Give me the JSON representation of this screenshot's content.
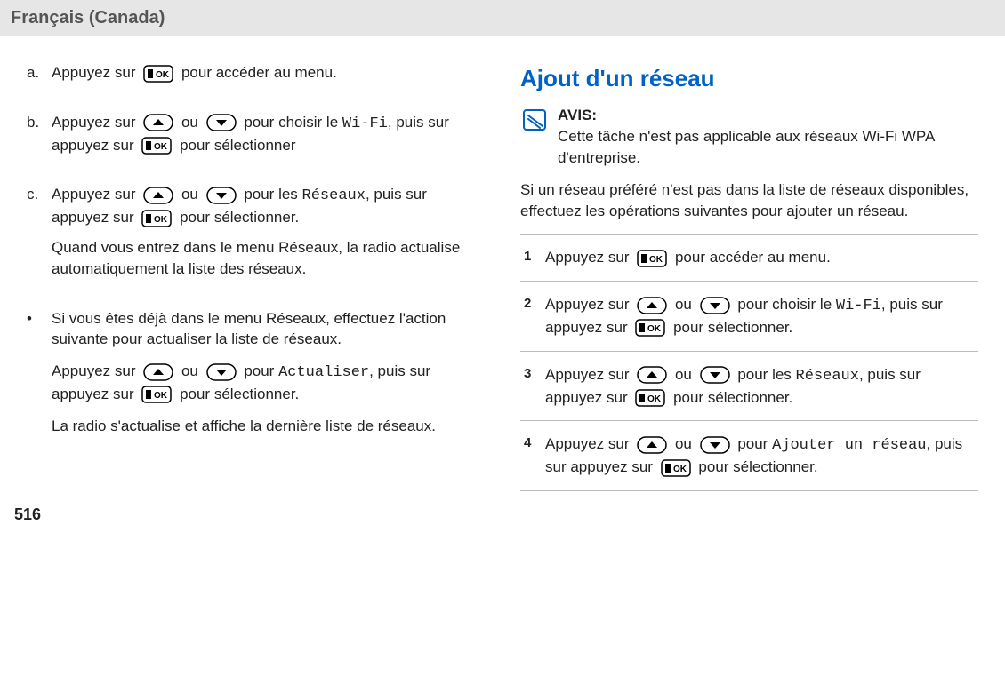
{
  "header": {
    "lang": "Français (Canada)"
  },
  "left": {
    "items": [
      {
        "marker": "a.",
        "segments": [
          {
            "parts": [
              {
                "t": "text",
                "v": "Appuyez sur "
              },
              {
                "t": "key",
                "v": "ok"
              },
              {
                "t": "text",
                "v": " pour accéder au menu."
              }
            ]
          }
        ]
      },
      {
        "marker": "b.",
        "segments": [
          {
            "parts": [
              {
                "t": "text",
                "v": "Appuyez sur "
              },
              {
                "t": "key",
                "v": "up"
              },
              {
                "t": "text",
                "v": " ou "
              },
              {
                "t": "key",
                "v": "down"
              },
              {
                "t": "text",
                "v": " pour choisir le "
              },
              {
                "t": "mono",
                "v": "Wi-Fi"
              },
              {
                "t": "text",
                "v": ", puis sur appuyez sur "
              },
              {
                "t": "key",
                "v": "ok"
              },
              {
                "t": "text",
                "v": " pour sélectionner"
              }
            ]
          }
        ]
      },
      {
        "marker": "c.",
        "segments": [
          {
            "parts": [
              {
                "t": "text",
                "v": "Appuyez sur "
              },
              {
                "t": "key",
                "v": "up"
              },
              {
                "t": "text",
                "v": " ou "
              },
              {
                "t": "key",
                "v": "down"
              },
              {
                "t": "text",
                "v": " pour les "
              },
              {
                "t": "mono",
                "v": "Réseaux"
              },
              {
                "t": "text",
                "v": ", puis sur appuyez sur "
              },
              {
                "t": "key",
                "v": "ok"
              },
              {
                "t": "text",
                "v": " pour sélectionner."
              }
            ]
          },
          {
            "parts": [
              {
                "t": "text",
                "v": "Quand vous entrez dans le menu Réseaux, la radio actualise automatiquement la liste des réseaux."
              }
            ]
          }
        ]
      }
    ],
    "bullet": {
      "marker": "•",
      "segments": [
        {
          "parts": [
            {
              "t": "text",
              "v": "Si vous êtes déjà dans le menu Réseaux, effectuez l'action suivante pour actualiser la liste de réseaux."
            }
          ]
        },
        {
          "parts": [
            {
              "t": "text",
              "v": "Appuyez sur "
            },
            {
              "t": "key",
              "v": "up"
            },
            {
              "t": "text",
              "v": " ou "
            },
            {
              "t": "key",
              "v": "down"
            },
            {
              "t": "text",
              "v": " pour "
            },
            {
              "t": "mono",
              "v": "Actualiser"
            },
            {
              "t": "text",
              "v": ", puis sur appuyez sur "
            },
            {
              "t": "key",
              "v": "ok"
            },
            {
              "t": "text",
              "v": " pour sélectionner."
            }
          ]
        },
        {
          "parts": [
            {
              "t": "text",
              "v": "La radio s'actualise et affiche la dernière liste de réseaux."
            }
          ]
        }
      ]
    }
  },
  "right": {
    "heading": "Ajout d'un réseau",
    "notice": {
      "title": "AVIS:",
      "body": "Cette tâche n'est pas applicable aux réseaux Wi-Fi WPA d'entreprise."
    },
    "intro": "Si un réseau préféré n'est pas dans la liste de réseaux disponibles, effectuez les opérations suivantes pour ajouter un réseau.",
    "steps": [
      {
        "num": "1",
        "segments": [
          {
            "parts": [
              {
                "t": "text",
                "v": "Appuyez sur "
              },
              {
                "t": "key",
                "v": "ok"
              },
              {
                "t": "text",
                "v": " pour accéder au menu."
              }
            ]
          }
        ]
      },
      {
        "num": "2",
        "segments": [
          {
            "parts": [
              {
                "t": "text",
                "v": "Appuyez sur "
              },
              {
                "t": "key",
                "v": "up"
              },
              {
                "t": "text",
                "v": " ou "
              },
              {
                "t": "key",
                "v": "down"
              },
              {
                "t": "text",
                "v": " pour choisir le "
              },
              {
                "t": "mono",
                "v": "Wi-Fi"
              },
              {
                "t": "text",
                "v": ", puis sur appuyez sur "
              },
              {
                "t": "key",
                "v": "ok"
              },
              {
                "t": "text",
                "v": " pour sélectionner."
              }
            ]
          }
        ]
      },
      {
        "num": "3",
        "segments": [
          {
            "parts": [
              {
                "t": "text",
                "v": "Appuyez sur "
              },
              {
                "t": "key",
                "v": "up"
              },
              {
                "t": "text",
                "v": " ou "
              },
              {
                "t": "key",
                "v": "down"
              },
              {
                "t": "text",
                "v": " pour les "
              },
              {
                "t": "mono",
                "v": "Réseaux"
              },
              {
                "t": "text",
                "v": ", puis sur appuyez sur "
              },
              {
                "t": "key",
                "v": "ok"
              },
              {
                "t": "text",
                "v": " pour sélectionner."
              }
            ]
          }
        ]
      },
      {
        "num": "4",
        "segments": [
          {
            "parts": [
              {
                "t": "text",
                "v": "Appuyez sur "
              },
              {
                "t": "key",
                "v": "up"
              },
              {
                "t": "text",
                "v": " ou "
              },
              {
                "t": "key",
                "v": "down"
              },
              {
                "t": "text",
                "v": " pour "
              },
              {
                "t": "mono",
                "v": "Ajouter un réseau"
              },
              {
                "t": "text",
                "v": ", puis sur appuyez sur "
              },
              {
                "t": "key",
                "v": "ok"
              },
              {
                "t": "text",
                "v": " pour sélectionner."
              }
            ]
          }
        ]
      }
    ]
  },
  "pagenum": "516"
}
